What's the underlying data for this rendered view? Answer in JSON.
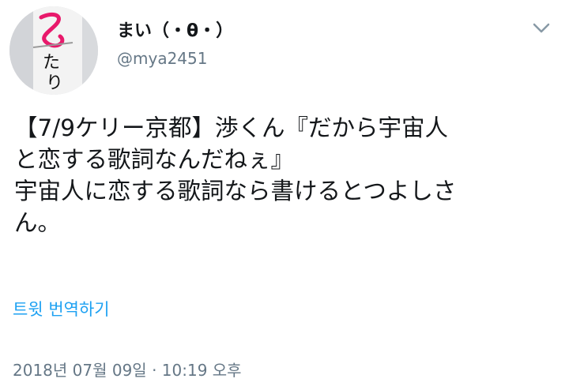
{
  "user": {
    "display_name": "まい（・θ・）",
    "handle": "@mya2451",
    "avatar_text": [
      "た",
      "り"
    ]
  },
  "tweet": {
    "lines": [
      "【7/9ケリー京都】渉くん『だから宇宙人",
      "と恋する歌詞なんだねぇ』",
      "宇宙人に恋する歌詞なら書けるとつよしさ",
      "ん。"
    ],
    "translate_label": "트윗 번역하기",
    "timestamp": "2018년 07월 09일 · 10:19 오후"
  },
  "colors": {
    "link": "#1da1f2",
    "secondary_text": "#657786",
    "primary_text": "#14171a",
    "avatar_mark": "#e8196b"
  },
  "icons": {
    "menu": "chevron-down-icon"
  }
}
